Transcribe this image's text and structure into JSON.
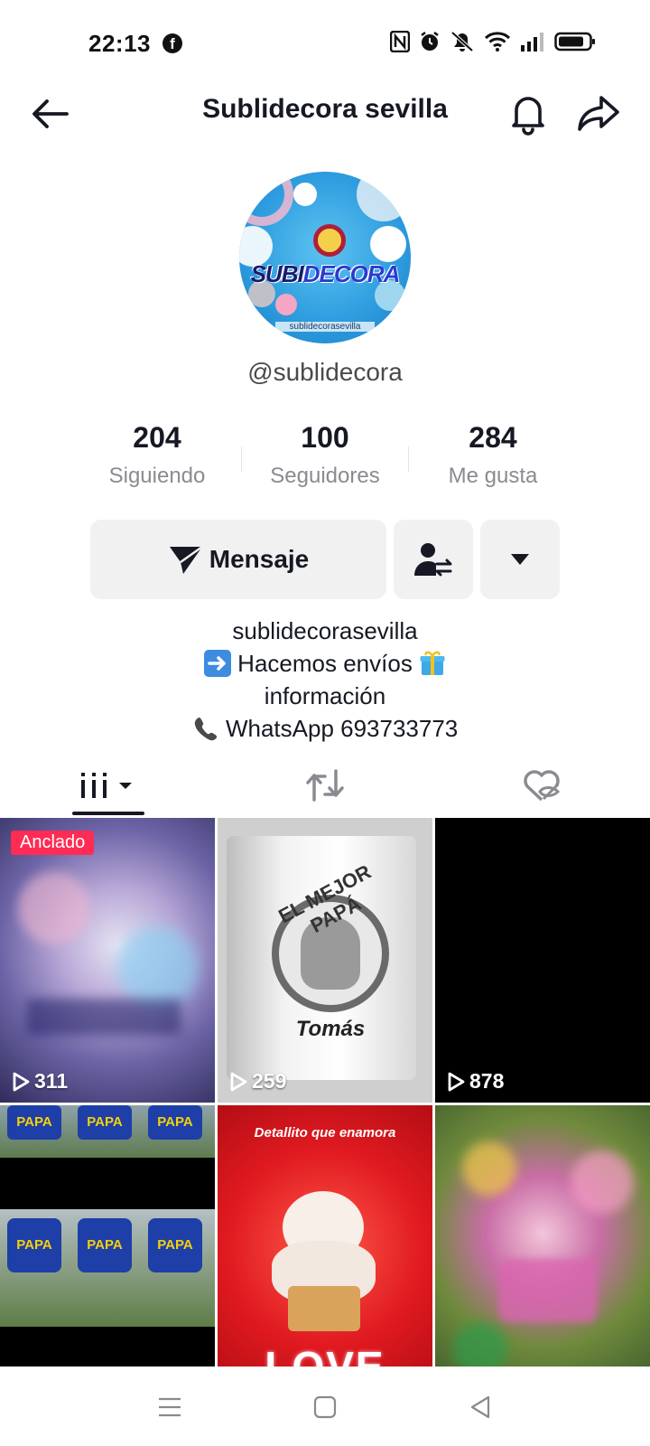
{
  "status_bar": {
    "time": "22:13"
  },
  "header": {
    "title": "Sublidecora sevilla"
  },
  "profile": {
    "avatar_text": {
      "left": "SUBI",
      "right": "DECORA",
      "caption": "sublidecorasevilla"
    },
    "handle": "@sublidecora",
    "stats": [
      {
        "value": "204",
        "label": "Siguiendo"
      },
      {
        "value": "100",
        "label": "Seguidores"
      },
      {
        "value": "284",
        "label": "Me gusta"
      }
    ],
    "message_button": "Mensaje",
    "bio": {
      "line1": "sublidecorasevilla",
      "line2": "Hacemos envíos",
      "line3": "información",
      "line4": "WhatsApp 693733773"
    }
  },
  "tabs": [
    "videos-tab-icon",
    "reposts-icon",
    "liked-hidden-icon"
  ],
  "videos": [
    {
      "views": "311",
      "pinned_label": "Anclado"
    },
    {
      "views": "259",
      "caption_1": "EL MEJOR PAPÁ",
      "caption_2": "Tomás"
    },
    {
      "views": "878"
    },
    {
      "views": "",
      "caption_1": "PAPA"
    },
    {
      "views": "",
      "caption_1": "Detallito que enamora",
      "caption_2": "LOVE"
    },
    {
      "views": ""
    }
  ],
  "colors": {
    "accent": "#fe2c55",
    "text": "#161823",
    "muted": "#8a8b91",
    "button_bg": "#f1f1f2"
  }
}
